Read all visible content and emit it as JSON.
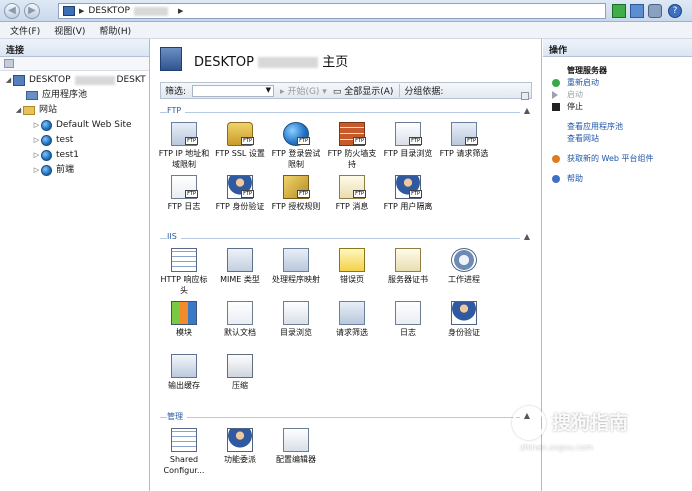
{
  "address": {
    "segment": "DESKTOP",
    "back_icon": "back-arrow-icon",
    "forward_icon": "forward-arrow-icon"
  },
  "menu": {
    "file": "文件(F)",
    "view": "视图(V)",
    "help": "帮助(H)"
  },
  "connections": {
    "title": "连接",
    "tree": [
      {
        "label": "DESKTOP",
        "suffix": "DESKT"
      },
      {
        "label": "应用程序池"
      },
      {
        "label": "网站"
      },
      {
        "label": "Default Web Site"
      },
      {
        "label": "test"
      },
      {
        "label": "test1"
      },
      {
        "label": "前端"
      }
    ]
  },
  "main": {
    "title_prefix": "DESKTOP",
    "title_suffix": "主页",
    "filter": {
      "label": "筛选:",
      "start": "开始(G)",
      "showall": "全部显示(A)",
      "groupby": "分组依据:"
    },
    "groups": [
      {
        "name": "FTP",
        "items": [
          "FTP IP 地址和域限制",
          "FTP SSL 设置",
          "FTP 登录尝试限制",
          "FTP 防火墙支持",
          "FTP 目录浏览",
          "FTP 请求筛选",
          "FTP 日志",
          "FTP 身份验证",
          "FTP 授权规则",
          "FTP 消息",
          "FTP 用户隔离"
        ]
      },
      {
        "name": "IIS",
        "items": [
          "HTTP 响应标头",
          "MIME 类型",
          "处理程序映射",
          "错误页",
          "服务器证书",
          "工作进程",
          "模块",
          "默认文档",
          "目录浏览",
          "请求筛选",
          "日志",
          "身份验证",
          "输出缓存",
          "压缩"
        ]
      },
      {
        "name": "管理",
        "items": [
          "Shared Configur...",
          "功能委派",
          "配置编辑器"
        ]
      }
    ],
    "ftp_badge": "FTP"
  },
  "actions": {
    "title": "操作",
    "items": [
      {
        "label": "管理服务器",
        "kind": "header"
      },
      {
        "label": "重新启动",
        "kind": "link"
      },
      {
        "label": "启动",
        "kind": "disabled"
      },
      {
        "label": "停止",
        "kind": "normal"
      },
      {
        "label": "查看应用程序池",
        "kind": "link"
      },
      {
        "label": "查看网站",
        "kind": "link"
      },
      {
        "label": "获取新的 Web 平台组件",
        "kind": "link"
      },
      {
        "label": "帮助",
        "kind": "link"
      }
    ]
  },
  "watermark": {
    "brand": "搜狗指南",
    "url": "zhinan.sogou.com"
  }
}
